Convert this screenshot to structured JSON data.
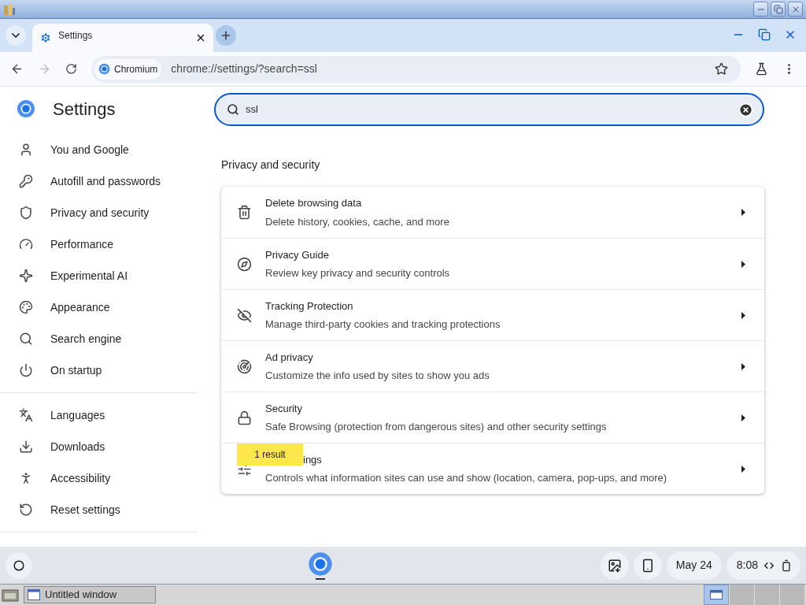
{
  "browser": {
    "tab": {
      "title": "Settings"
    },
    "site_chip": "Chromium",
    "url": "chrome://settings/?search=ssl"
  },
  "sidebar": {
    "title": "Settings",
    "groups": [
      [
        {
          "label": "You and Google"
        },
        {
          "label": "Autofill and passwords"
        },
        {
          "label": "Privacy and security"
        },
        {
          "label": "Performance"
        },
        {
          "label": "Experimental AI"
        },
        {
          "label": "Appearance"
        },
        {
          "label": "Search engine"
        },
        {
          "label": "On startup"
        }
      ],
      [
        {
          "label": "Languages"
        },
        {
          "label": "Downloads"
        },
        {
          "label": "Accessibility"
        },
        {
          "label": "Reset settings"
        }
      ]
    ]
  },
  "search": {
    "value": "ssl"
  },
  "section": {
    "title": "Privacy and security",
    "rows": [
      {
        "title": "Delete browsing data",
        "subtitle": "Delete history, cookies, cache, and more"
      },
      {
        "title": "Privacy Guide",
        "subtitle": "Review key privacy and security controls"
      },
      {
        "title": "Tracking Protection",
        "subtitle": "Manage third-party cookies and tracking protections"
      },
      {
        "title": "Ad privacy",
        "subtitle": "Customize the info used by sites to show you ads"
      },
      {
        "title": "Security",
        "subtitle": "Safe Browsing (protection from dangerous sites) and other security settings"
      },
      {
        "title": "ings",
        "subtitle": "Controls what information sites can use and show (location, camera, pop-ups, and more)",
        "bubble": "1 result"
      }
    ]
  },
  "shelf": {
    "date": "May 24",
    "time": "8:08"
  },
  "taskbar": {
    "window": "Untitled window"
  }
}
